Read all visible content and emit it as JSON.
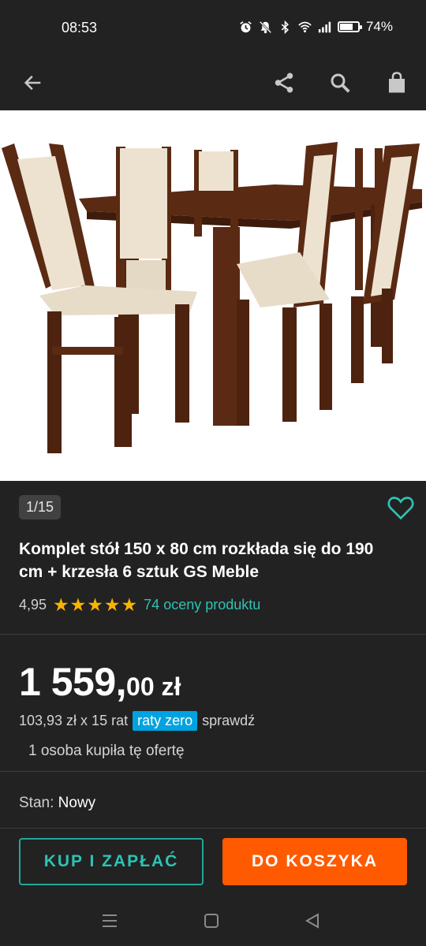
{
  "status_bar": {
    "time": "08:53",
    "battery": "74%",
    "battery_level": 0.74,
    "icons": [
      "alarm-icon",
      "mute-icon",
      "bluetooth-icon",
      "wifi-icon",
      "signal-icon",
      "battery-icon"
    ]
  },
  "toolbar": {
    "icons": [
      "back-arrow-icon",
      "share-icon",
      "search-icon",
      "shopping-bag-icon"
    ]
  },
  "product": {
    "image_counter": "1/15",
    "title": "Komplet stół 150 x 80 cm rozkłada się do 190 cm + krzesła 6 sztuk GS Meble",
    "rating_value": "4,95",
    "stars": 5,
    "rating_count": "74 oceny produktu",
    "price_integer": "1 559,",
    "price_decimal": "00",
    "price_currency": " zł",
    "installments_text": "103,93 zł x 15 rat",
    "installments_badge": "raty zero",
    "installments_link": "sprawdź",
    "bought_text": "1 osoba kupiła tę ofertę",
    "condition_label": "Stan:",
    "condition_value": "Nowy"
  },
  "actions": {
    "buy_label": "KUP I ZAPŁAĆ",
    "cart_label": "DO KOSZYKA"
  },
  "colors": {
    "background": "#222222",
    "accent_teal": "#2ec2b4",
    "star": "#f7b500",
    "cart_orange": "#ff5a00",
    "badge_blue": "#00a3e0"
  },
  "system_nav": {
    "icons": [
      "recents-icon",
      "home-icon",
      "back-triangle-icon"
    ]
  }
}
